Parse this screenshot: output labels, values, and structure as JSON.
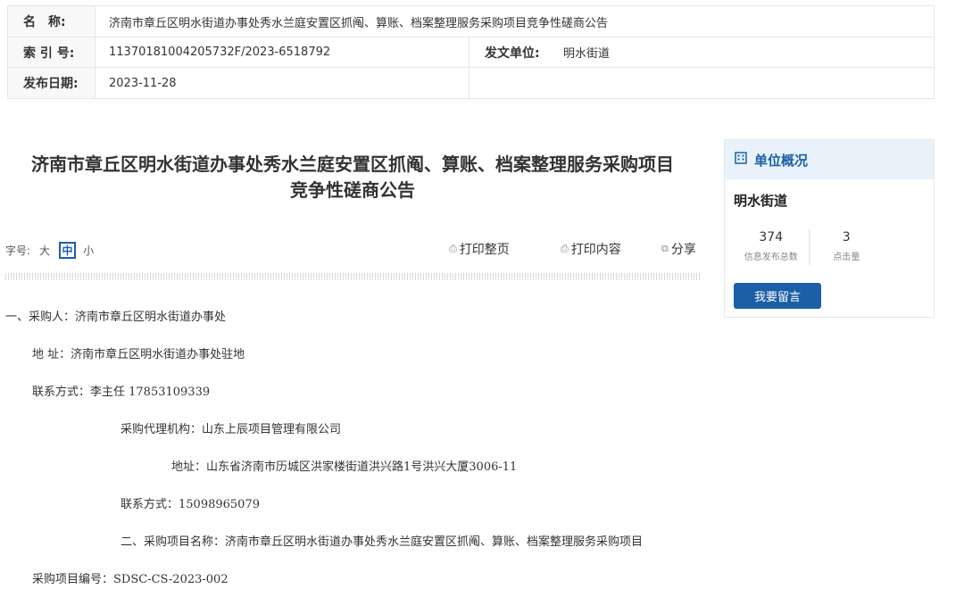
{
  "meta": {
    "name_label": "名　称:",
    "name_value": "济南市章丘区明水街道办事处秀水兰庭安置区抓阄、算账、档案整理服务采购项目竞争性磋商公告",
    "index_label": "索 引 号:",
    "index_value": "11370181004205732F/2023-6518792",
    "issuer_label": "发文单位:",
    "issuer_value": "明水街道",
    "date_label": "发布日期:",
    "date_value": "2023-11-28"
  },
  "article": {
    "title_line1": "济南市章丘区明水街道办事处秀水兰庭安置区抓阄、算账、档案整理服务采购项目",
    "title_line2": "竞争性磋商公告"
  },
  "toolbar": {
    "fontsize_label": "字号:",
    "size_large": "大",
    "size_medium": "中",
    "size_small": "小",
    "print_page": "打印整页",
    "print_content": "打印内容",
    "share": "分享"
  },
  "body": [
    "一、采购人：济南市章丘区明水街道办事处",
    "地 址：济南市章丘区明水街道办事处驻地",
    "联系方式：李主任 17853109339",
    "采购代理机构：山东上辰项目管理有限公司",
    "地址：山东省济南市历城区洪家楼街道洪兴路1号洪兴大厦3006-11",
    "联系方式：15098965079",
    "二、采购项目名称：济南市章丘区明水街道办事处秀水兰庭安置区抓阄、算账、档案整理服务采购项目",
    "采购项目编号：SDSC-CS-2023-002"
  ],
  "sidebar": {
    "heading": "单位概况",
    "heading_icon": "building-icon",
    "unit_name": "明水街道",
    "stat1_value": "374",
    "stat1_caption": "信息发布总数",
    "stat2_value": "3",
    "stat2_caption": "点击量",
    "message_button": "我要留言"
  },
  "colors": {
    "accent": "#1a5fa8",
    "sidebar_header_bg": "#e9f2fb"
  }
}
